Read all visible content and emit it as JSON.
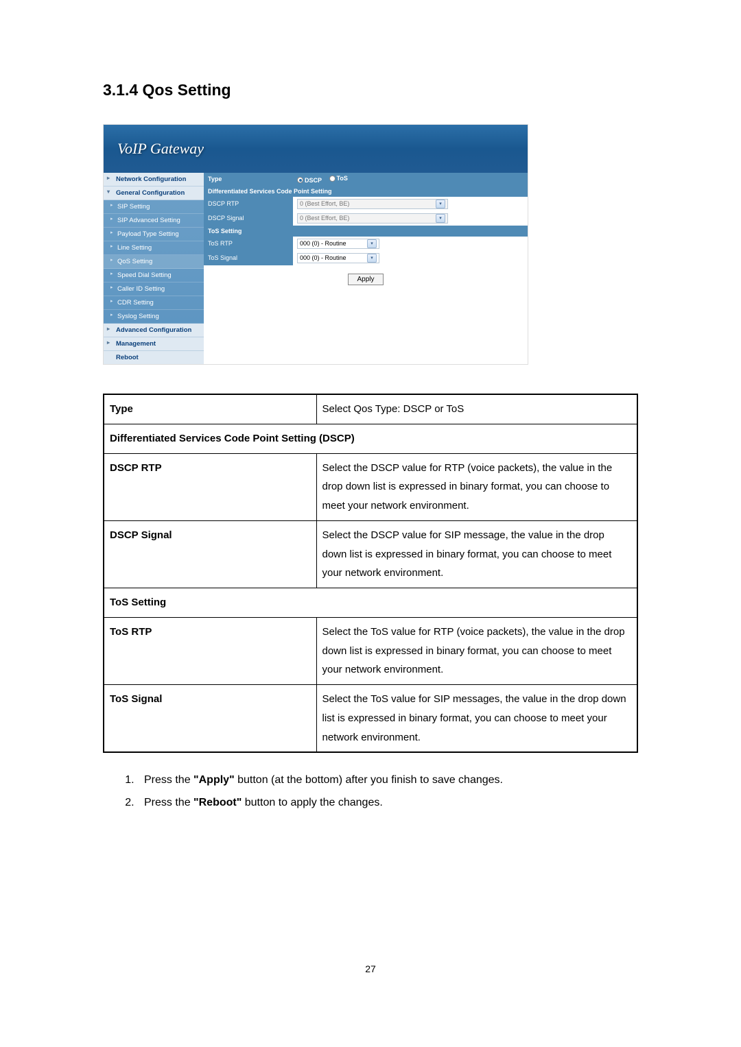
{
  "heading": "3.1.4  Qos Setting",
  "app": {
    "brand": "VoIP  Gateway",
    "sidebar": {
      "sections": [
        {
          "label": "Network Configuration",
          "type": "section"
        },
        {
          "label": "General Configuration",
          "type": "section"
        },
        {
          "label": "SIP Setting",
          "type": "item"
        },
        {
          "label": "SIP Advanced Setting",
          "type": "item"
        },
        {
          "label": "Payload Type Setting",
          "type": "item"
        },
        {
          "label": "Line Setting",
          "type": "item"
        },
        {
          "label": "QoS Setting",
          "type": "item",
          "active": true
        },
        {
          "label": "Speed Dial Setting",
          "type": "item"
        },
        {
          "label": "Caller ID Setting",
          "type": "item"
        },
        {
          "label": "CDR Setting",
          "type": "item"
        },
        {
          "label": "Syslog Setting",
          "type": "item"
        },
        {
          "label": "Advanced Configuration",
          "type": "section"
        },
        {
          "label": "Management",
          "type": "section"
        },
        {
          "label": "Reboot",
          "type": "plain"
        }
      ]
    },
    "form": {
      "type_label": "Type",
      "type_options": {
        "dscp": "DSCP",
        "tos": "ToS"
      },
      "dscp_section": "Differentiated Services Code Point Setting",
      "dscp_rtp": {
        "label": "DSCP RTP",
        "value": "0 (Best Effort, BE)"
      },
      "dscp_signal": {
        "label": "DSCP Signal",
        "value": "0 (Best Effort, BE)"
      },
      "tos_section": "ToS Setting",
      "tos_rtp": {
        "label": "ToS RTP",
        "value": "000 (0) - Routine"
      },
      "tos_signal": {
        "label": "ToS Signal",
        "value": "000 (0) - Routine"
      },
      "apply": "Apply"
    }
  },
  "doc_table": {
    "rows": [
      {
        "label": "Type",
        "desc": "Select Qos Type: DSCP or ToS"
      },
      {
        "full": "Differentiated Services Code Point Setting (DSCP)"
      },
      {
        "label": "DSCP RTP",
        "desc": "Select the DSCP value for RTP (voice packets), the value in the drop down list is expressed in binary format, you can choose to meet your network environment."
      },
      {
        "label": "DSCP Signal",
        "desc": "Select the DSCP value for SIP message, the value in the drop down list is expressed in binary format, you can choose to meet your network environment."
      },
      {
        "full": "ToS Setting"
      },
      {
        "label": "ToS RTP",
        "desc": "Select the ToS value for RTP (voice packets), the value in the drop down list is expressed in binary format, you can choose to meet your network environment."
      },
      {
        "label": "ToS Signal",
        "desc": "Select the ToS value for SIP messages, the value in the drop down list is expressed in binary format, you can choose to meet your network environment."
      }
    ]
  },
  "instructions": {
    "i1_a": "Press the ",
    "i1_b": "\"Apply\"",
    "i1_c": " button (at the bottom) after you finish to save changes.",
    "i2_a": "Press the ",
    "i2_b": "\"Reboot\"",
    "i2_c": " button to apply the changes."
  },
  "page_number": "27"
}
